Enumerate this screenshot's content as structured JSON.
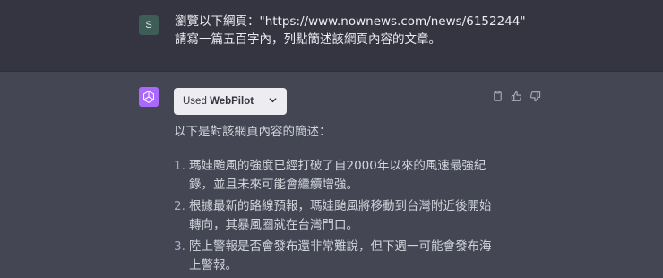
{
  "user_message": {
    "avatar_letter": "S",
    "line1": "瀏覽以下網頁：\"https://www.nownews.com/news/6152244\"",
    "line2": "請寫一篇五百字內，列點簡述該網頁內容的文章。"
  },
  "assistant_message": {
    "plugin": {
      "prefix": "Used",
      "name": "WebPilot",
      "icon": "chevron-down-icon"
    },
    "action_icons": [
      "copy-icon",
      "thumbs-up-icon",
      "thumbs-down-icon"
    ],
    "intro": "以下是對該網頁內容的簡述：",
    "items": [
      {
        "num": "1.",
        "text": "瑪娃颱風的強度已經打破了自2000年以來的風速最強紀錄，並且未來可能會繼續增強。"
      },
      {
        "num": "2.",
        "text": "根據最新的路線預報，瑪娃颱風將移動到台灣附近後開始轉向，其暴風圈就在台灣門口。"
      },
      {
        "num": "3.",
        "text": "陸上警報是否會發布還非常難說，但下週一可能會發布海上警報。"
      }
    ]
  },
  "colors": {
    "user_bg": "#343541",
    "assistant_bg": "#444654",
    "user_avatar": "#3f5d57",
    "gpt_avatar": "#ab68ff",
    "pill_bg": "#ececf1"
  }
}
